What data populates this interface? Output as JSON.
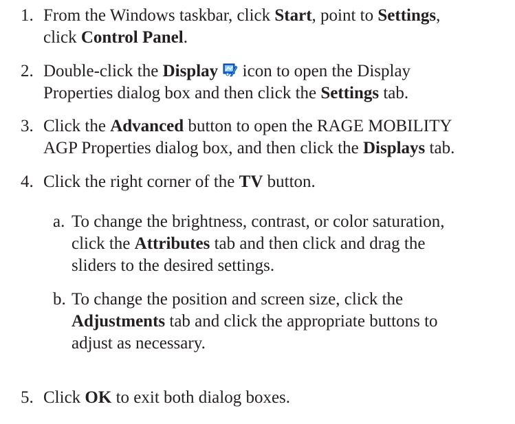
{
  "steps": [
    {
      "num": "1.",
      "parts": [
        "From the Windows taskbar, click ",
        "Start",
        ", point to ",
        "Settings",
        ",",
        "click ",
        "Control Panel",
        "."
      ]
    },
    {
      "num": "2.",
      "parts": [
        "Double-click the ",
        "Display",
        " icon to open the Display",
        "Properties dialog box and then click the ",
        "Settings",
        " tab."
      ],
      "icon": "display-properties-icon"
    },
    {
      "num": "3.",
      "parts": [
        "Click the ",
        "Advanced",
        " button to open the RAGE MOBILITY",
        "AGP Properties dialog box, and then click the ",
        "Displays",
        " tab."
      ]
    },
    {
      "num": "4.",
      "parts": [
        "Click the right corner of the ",
        "TV",
        " button."
      ]
    },
    {
      "num": "5.",
      "parts": [
        "Click ",
        "OK",
        " to exit both dialog boxes."
      ]
    }
  ],
  "substeps": [
    {
      "num": "a.",
      "parts": [
        "To change the brightness, contrast, or color saturation,",
        "click the ",
        "Attributes",
        " tab and then click and drag the",
        "sliders to the desired settings."
      ]
    },
    {
      "num": "b.",
      "parts": [
        "To change the position and screen size, click the",
        "Adjustments",
        " tab and click the appropriate buttons to",
        "adjust as necessary."
      ]
    }
  ]
}
